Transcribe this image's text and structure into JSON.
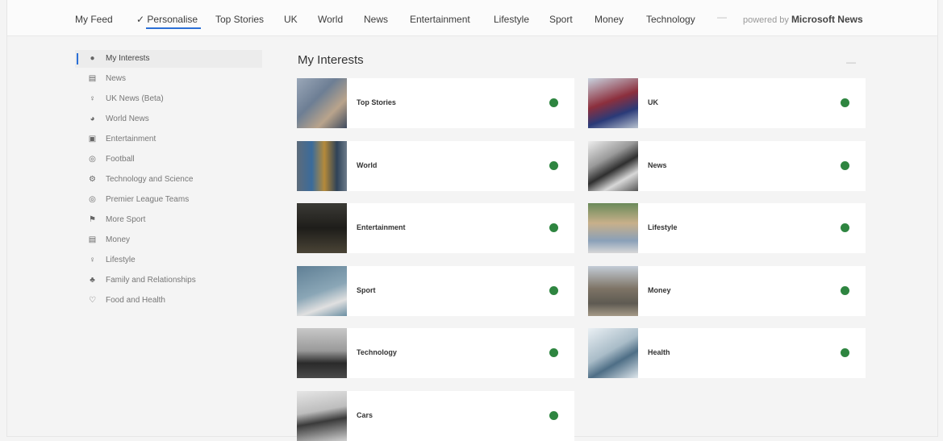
{
  "nav": {
    "items": [
      {
        "label": "My Feed"
      },
      {
        "label": "✓ Personalise"
      },
      {
        "label": "Top Stories"
      },
      {
        "label": "UK"
      },
      {
        "label": "World"
      },
      {
        "label": "News"
      },
      {
        "label": "Entertainment"
      },
      {
        "label": "Lifestyle"
      },
      {
        "label": "Sport"
      },
      {
        "label": "Money"
      },
      {
        "label": "Technology"
      }
    ],
    "more": "—",
    "powered_prefix": "powered by",
    "powered_brand": "Microsoft News"
  },
  "sidebar": {
    "items": [
      {
        "label": "My Interests",
        "icon": "heart-icon",
        "glyph": "●"
      },
      {
        "label": "News",
        "icon": "newspaper-icon",
        "glyph": "▤"
      },
      {
        "label": "UK News (Beta)",
        "icon": "person-icon",
        "glyph": "♀"
      },
      {
        "label": "World News",
        "icon": "globe-icon",
        "glyph": "◕"
      },
      {
        "label": "Entertainment",
        "icon": "tv-icon",
        "glyph": "▣"
      },
      {
        "label": "Football",
        "icon": "football-icon",
        "glyph": "◎"
      },
      {
        "label": "Technology and Science",
        "icon": "gear-icon",
        "glyph": "⚙"
      },
      {
        "label": "Premier League Teams",
        "icon": "ball-icon",
        "glyph": "◎"
      },
      {
        "label": "More Sport",
        "icon": "trophy-icon",
        "glyph": "⚑"
      },
      {
        "label": "Money",
        "icon": "money-icon",
        "glyph": "▤"
      },
      {
        "label": "Lifestyle",
        "icon": "lifestyle-icon",
        "glyph": "♀"
      },
      {
        "label": "Family and Relationships",
        "icon": "family-icon",
        "glyph": "♣"
      },
      {
        "label": "Food and Health",
        "icon": "food-icon",
        "glyph": "♡"
      }
    ]
  },
  "main": {
    "title": "My Interests",
    "dash": "—",
    "cards": [
      {
        "label": "Top Stories",
        "thumb": "linear-gradient(135deg,#9aa7b8 0%,#6d7e94 40%,#b9a48c 70%,#3f4b5e 100%)"
      },
      {
        "label": "UK",
        "thumb": "linear-gradient(160deg,#c9d3df 0%,#8c2f3d 45%,#2a3a78 70%,#b8c2cf 100%)"
      },
      {
        "label": "World",
        "thumb": "linear-gradient(90deg,#5d6b7a 0%,#3a6b9b 30%,#b58a3a 55%,#2f4358 80%,#6c7b8a 100%)"
      },
      {
        "label": "News",
        "thumb": "linear-gradient(150deg,#eeeeee 0%,#9a9a9a 35%,#2f2f2f 55%,#d8d8d8 75%,#555555 100%)"
      },
      {
        "label": "Entertainment",
        "thumb": "linear-gradient(180deg,#3b3a35 0%,#1e1d1a 50%,#4a4436 100%)"
      },
      {
        "label": "Lifestyle",
        "thumb": "linear-gradient(180deg,#6a8a5a 0%,#c8b08a 40%,#8aa0b8 75%,#d7d7d7 100%)"
      },
      {
        "label": "Sport",
        "thumb": "linear-gradient(160deg,#5f7f95 0%,#8aa6b6 50%,#e0e0e0 75%,#6b8fa3 100%)"
      },
      {
        "label": "Money",
        "thumb": "linear-gradient(180deg,#c3ccd6 0%,#7e7466 45%,#5e5a52 75%,#a59a88 100%)"
      },
      {
        "label": "Technology",
        "thumb": "linear-gradient(180deg,#c8c8c8 0%,#9a9a9a 45%,#2a2a2a 70%,#4a4a4a 100%)"
      },
      {
        "label": "Health",
        "thumb": "linear-gradient(150deg,#eaf0f4 0%,#a9bcc8 45%,#4e6e86 65%,#dfe7ec 100%)"
      },
      {
        "label": "Cars",
        "thumb": "linear-gradient(170deg,#e6e6e6 0%,#bdbdbd 40%,#3a3a3a 60%,#d0d0d0 100%)"
      }
    ]
  },
  "colors": {
    "accent": "#2b6fd6",
    "status_dot": "#2e8540"
  }
}
